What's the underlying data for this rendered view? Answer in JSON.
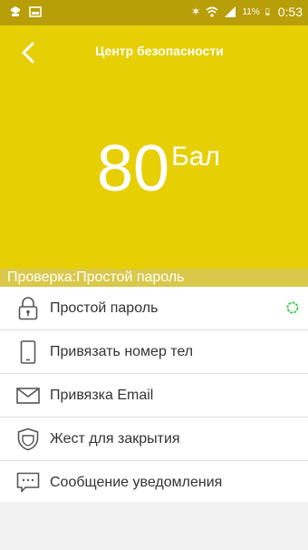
{
  "status_bar": {
    "battery": "11%",
    "time": "0:53"
  },
  "header": {
    "title": "Центр безопасности"
  },
  "score": {
    "value": "80",
    "unit": "Бал"
  },
  "check": {
    "text": "Проверка:Простой пароль"
  },
  "items": [
    {
      "label": "Простой пароль",
      "icon": "lock-icon"
    },
    {
      "label": "Привязать номер тел",
      "icon": "phone-icon"
    },
    {
      "label": "Привязка Email",
      "icon": "email-icon"
    },
    {
      "label": "Жест для закрытия",
      "icon": "shield-icon"
    },
    {
      "label": "Сообщение уведомления",
      "icon": "message-icon"
    }
  ],
  "colors": {
    "accent": "#e6cf05",
    "status_ring": "#2ecc40"
  }
}
